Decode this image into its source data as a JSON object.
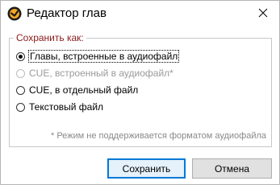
{
  "window": {
    "title": "Редактор глав",
    "icon": "app-logo-icon",
    "close_icon": "close-icon"
  },
  "group": {
    "legend": "Сохранить как:",
    "options": [
      {
        "label": "Главы, встроенные в аудиофайл",
        "checked": true,
        "enabled": true
      },
      {
        "label": "CUE, встроенный в аудиофайл*",
        "checked": false,
        "enabled": false
      },
      {
        "label": "CUE, в отдельный файл",
        "checked": false,
        "enabled": true
      },
      {
        "label": "Текстовый файл",
        "checked": false,
        "enabled": true
      }
    ],
    "note": "* Режим не поддерживается форматом аудиофайла"
  },
  "buttons": {
    "save_label": "Сохранить",
    "cancel_label": "Отмена"
  },
  "colors": {
    "legend": "#8b1a1a",
    "accent": "#0078d7",
    "disabled_text": "#9a9a9a",
    "icon_orange": "#f5a623"
  }
}
